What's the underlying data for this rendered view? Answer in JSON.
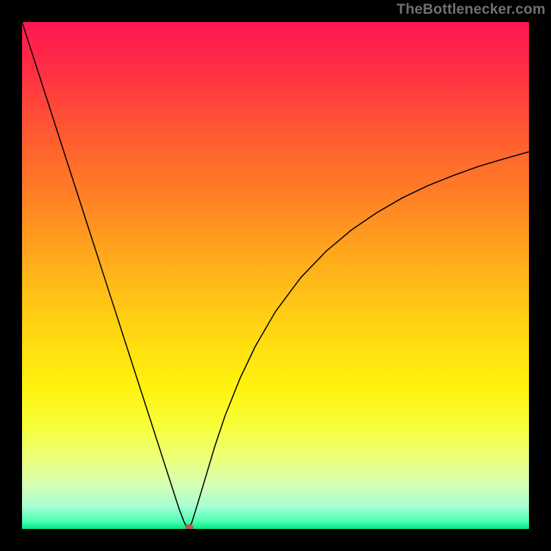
{
  "watermark": "TheBottlenecker.com",
  "chart_data": {
    "type": "line",
    "title": "",
    "xlabel": "",
    "ylabel": "",
    "xlim": [
      0,
      100
    ],
    "ylim": [
      0,
      100
    ],
    "background": {
      "type": "vertical-gradient",
      "stops": [
        {
          "offset": 0.0,
          "color": "#ff1750"
        },
        {
          "offset": 0.1,
          "color": "#ff3044"
        },
        {
          "offset": 0.22,
          "color": "#ff5a30"
        },
        {
          "offset": 0.35,
          "color": "#ff8225"
        },
        {
          "offset": 0.48,
          "color": "#ffaf1a"
        },
        {
          "offset": 0.6,
          "color": "#ffd411"
        },
        {
          "offset": 0.72,
          "color": "#fff30e"
        },
        {
          "offset": 0.8,
          "color": "#f7ff3a"
        },
        {
          "offset": 0.86,
          "color": "#ecff7a"
        },
        {
          "offset": 0.91,
          "color": "#d7ffb0"
        },
        {
          "offset": 0.955,
          "color": "#a8ffd4"
        },
        {
          "offset": 0.985,
          "color": "#4cffb2"
        },
        {
          "offset": 1.0,
          "color": "#00e884"
        }
      ]
    },
    "series": [
      {
        "name": "bottleneck-curve",
        "color": "#000000",
        "width": 1.6,
        "x": [
          0,
          2,
          4,
          6,
          8,
          10,
          12,
          14,
          16,
          18,
          20,
          22,
          24,
          26,
          28,
          30,
          31,
          32,
          32.5,
          33,
          33.5,
          34.5,
          36,
          38,
          40,
          43,
          46,
          50,
          55,
          60,
          65,
          70,
          75,
          80,
          85,
          90,
          95,
          100
        ],
        "y": [
          100,
          93.8,
          87.6,
          81.4,
          75.2,
          69,
          62.8,
          56.6,
          50.4,
          44.2,
          38,
          31.8,
          25.6,
          19.4,
          13.2,
          7,
          3.9,
          1.3,
          0.4,
          0.4,
          1.3,
          4.5,
          9.5,
          16.2,
          22.2,
          29.7,
          36,
          42.9,
          49.6,
          54.8,
          59,
          62.4,
          65.3,
          67.7,
          69.7,
          71.5,
          73,
          74.4
        ]
      }
    ],
    "marker": {
      "name": "optimal-point",
      "x": 33,
      "y": 0.3,
      "color": "#c05a4a",
      "size": 6
    }
  }
}
